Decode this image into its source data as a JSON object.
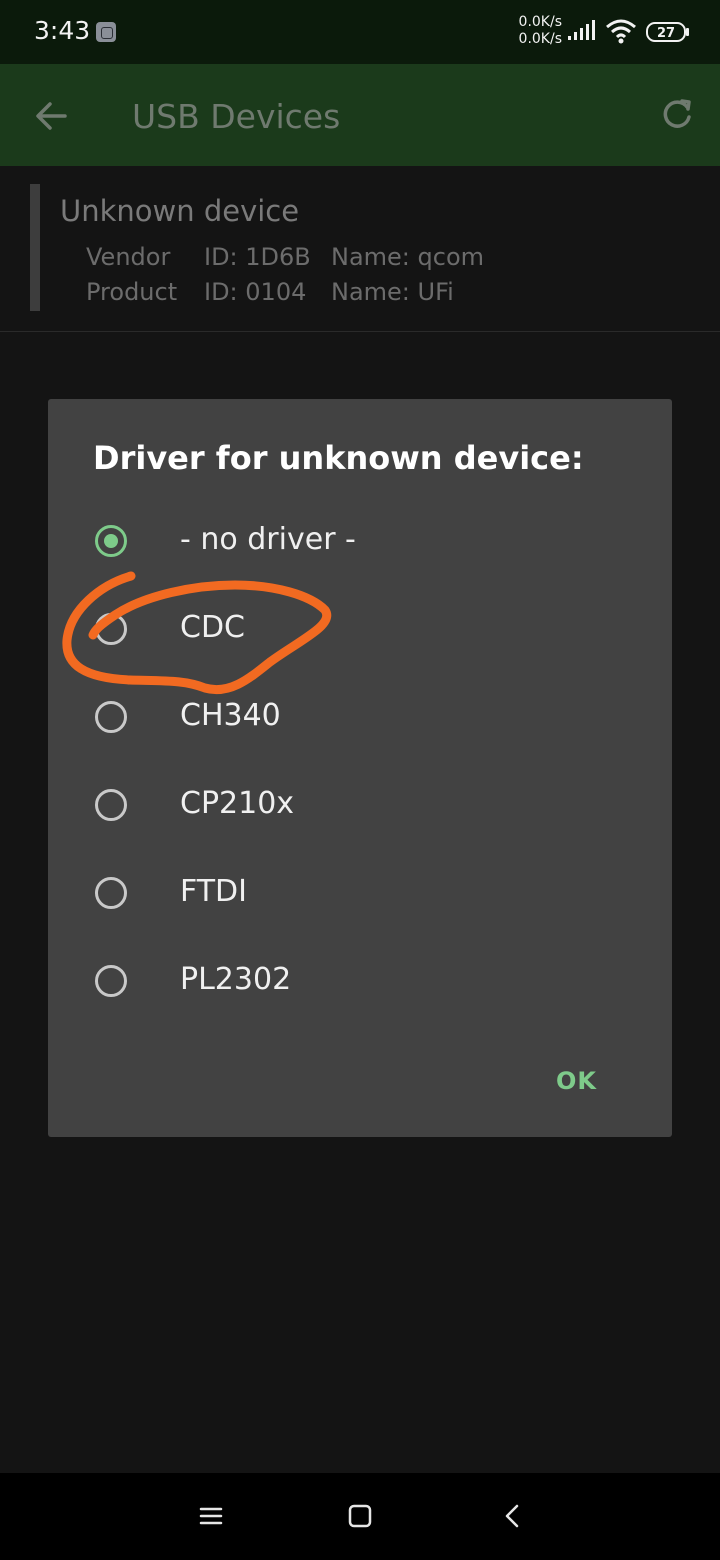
{
  "status_bar": {
    "time": "3:43",
    "speed_up": "0.0K/s",
    "speed_down": "0.0K/s",
    "battery": "27"
  },
  "app_bar": {
    "title": "USB Devices"
  },
  "device": {
    "name": "Unknown device",
    "vendor_label": "Vendor",
    "vendor_id": "ID: 1D6B",
    "vendor_name": "Name: qcom",
    "product_label": "Product",
    "product_id": "ID: 0104",
    "product_name": "Name: UFi"
  },
  "dialog": {
    "title": "Driver for unknown device:",
    "options": [
      {
        "label": "- no driver -",
        "selected": true
      },
      {
        "label": "CDC",
        "selected": false
      },
      {
        "label": "CH340",
        "selected": false
      },
      {
        "label": "CP210x",
        "selected": false
      },
      {
        "label": "FTDI",
        "selected": false
      },
      {
        "label": "PL2302",
        "selected": false
      }
    ],
    "ok_label": "OK"
  },
  "colors": {
    "accent": "#7ecb8a",
    "annotation": "#f26a21",
    "app_bar": "#1b3a1b"
  }
}
